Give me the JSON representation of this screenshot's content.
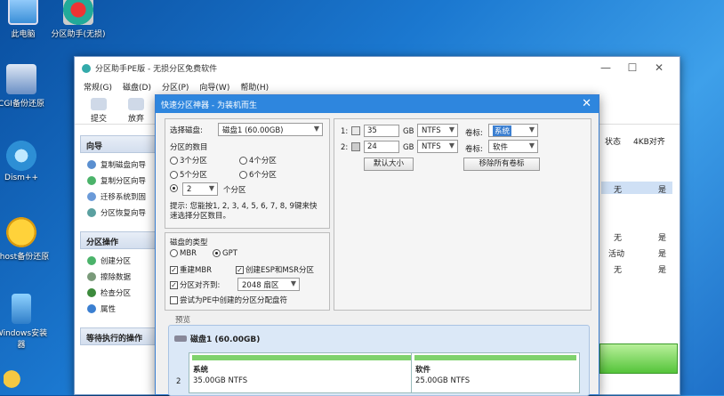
{
  "desktop": {
    "icons": [
      {
        "label": "此电脑"
      },
      {
        "label": "分区助手(无损)"
      },
      {
        "label": "CGI备份还原"
      },
      {
        "label": "Dism++"
      },
      {
        "label": "Ghost备份还原"
      },
      {
        "label": "Windows安装器"
      }
    ]
  },
  "app": {
    "title": "分区助手PE版 - 无损分区免费软件",
    "menu": [
      "常规(G)",
      "磁盘(D)",
      "分区(P)",
      "向导(W)",
      "帮助(H)"
    ],
    "toolbar": [
      "提交",
      "放弃"
    ],
    "wizard_header": "向导",
    "wizard_items": [
      "复制磁盘向导",
      "复制分区向导",
      "迁移系统到固",
      "分区恢复向导"
    ],
    "partition_header": "分区操作",
    "partition_items": [
      "创建分区",
      "擦除数据",
      "检查分区",
      "属性"
    ],
    "pending_header": "等待执行的操作",
    "columns": [
      "状态",
      "4KB对齐"
    ],
    "rows": [
      [
        "无",
        "是"
      ],
      [
        "无",
        "是"
      ],
      [
        "活动",
        "是"
      ],
      [
        "无",
        "是"
      ]
    ]
  },
  "dialog": {
    "title": "快速分区神器 - 为装机而生",
    "select_disk_label": "选择磁盘:",
    "select_disk_value": "磁盘1 (60.00GB)",
    "count_label": "分区的数目",
    "opt3": "3个分区",
    "opt4": "4个分区",
    "opt5": "5个分区",
    "opt6": "6个分区",
    "custom_count": "2",
    "custom_suffix": "个分区",
    "hint": "提示: 您能按1, 2, 3, 4, 5, 6, 7, 8, 9键来快速选择分区数目。",
    "disk_type_label": "磁盘的类型",
    "mbr": "MBR",
    "gpt": "GPT",
    "rebuild_mbr": "重建MBR",
    "create_esp": "创建ESP和MSR分区",
    "align_label": "分区对齐到:",
    "align_value": "2048 扇区",
    "pe_letter": "尝试为PE中创建的分区分配盘符",
    "partitions": [
      {
        "index": "1:",
        "size": "35",
        "unit": "GB",
        "fs": "NTFS",
        "label_text": "卷标:",
        "label": "系统"
      },
      {
        "index": "2:",
        "size": "24",
        "unit": "GB",
        "fs": "NTFS",
        "label_text": "卷标:",
        "label": "软件"
      }
    ],
    "default_size_btn": "默认大小",
    "remove_labels_btn": "移除所有卷标",
    "preview_label": "预览",
    "preview_disk": "磁盘1 (60.00GB)",
    "preview_segments": [
      {
        "name": "系统",
        "info": "35.00GB NTFS"
      },
      {
        "name": "软件",
        "info": "25.00GB NTFS"
      }
    ],
    "preview_index": "2"
  }
}
